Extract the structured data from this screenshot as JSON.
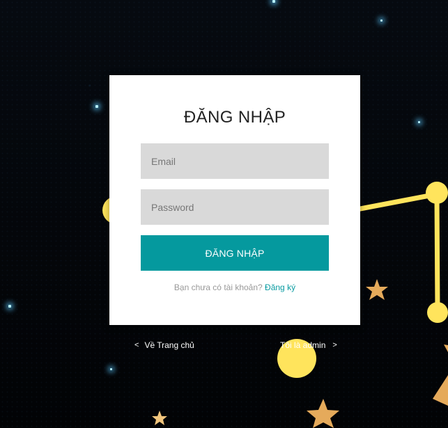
{
  "theme": {
    "accent": "#05999E",
    "link_color": "#0A9CA2",
    "field_background": "#D9D9D9",
    "card_background": "#FFFFFF",
    "page_background": "#05070B",
    "decor_yellow": "#FFE45C",
    "decor_star": "#E5AA5B"
  },
  "login": {
    "title": "ĐĂNG NHẬP",
    "email_placeholder": "Email",
    "password_placeholder": "Password",
    "submit_label": "ĐĂNG NHẬP",
    "signup_prompt": "Bạn chưa có tài khoản?",
    "signup_link": "Đăng ký"
  },
  "navigation": {
    "home_label": "Về Trang chủ",
    "admin_label": "Tôi là admin",
    "left_chevron": "<",
    "right_chevron": ">"
  },
  "decorations": {
    "sparkle_icon": "sparkle-icon",
    "star_icon": "star-icon",
    "constellation_icon": "constellation-lines"
  }
}
